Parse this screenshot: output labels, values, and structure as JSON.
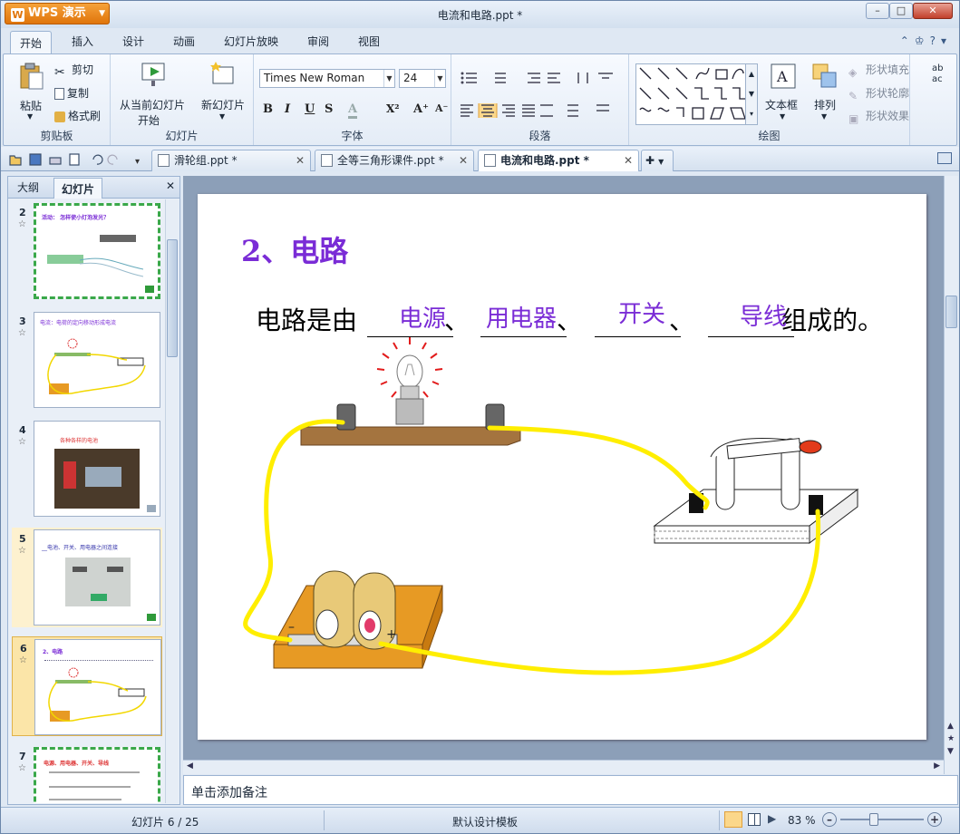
{
  "app": {
    "name": "WPS 演示",
    "title": "电流和电路.ppt *"
  },
  "window_controls": {
    "min": "–",
    "max": "□",
    "close": "✕"
  },
  "ribbon_tabs": [
    "开始",
    "插入",
    "设计",
    "动画",
    "幻灯片放映",
    "审阅",
    "视图"
  ],
  "clipboard": {
    "paste": "粘贴",
    "cut": "剪切",
    "copy": "复制",
    "format_painter": "格式刷",
    "label": "剪贴板"
  },
  "slides_group": {
    "from_current_line1": "从当前幻灯片",
    "from_current_line2": "开始",
    "new_slide": "新幻灯片",
    "label": "幻灯片"
  },
  "font": {
    "name": "Times New Roman",
    "size": "24",
    "label": "字体",
    "bold": "B",
    "italic": "I",
    "underline": "U",
    "strike": "S",
    "color": "A",
    "superscript": "X²",
    "grow": "A⁺",
    "shrink": "A⁻"
  },
  "paragraph": {
    "label": "段落"
  },
  "drawing": {
    "textbox": "文本框",
    "arrange": "排列",
    "shape_fill": "形状填充",
    "shape_outline": "形状轮廓",
    "shape_effect": "形状效果",
    "label": "绘图"
  },
  "doc_tabs": [
    {
      "label": "滑轮组.ppt *",
      "active": false
    },
    {
      "label": "全等三角形课件.ppt *",
      "active": false
    },
    {
      "label": "电流和电路.ppt *",
      "active": true
    }
  ],
  "left_pane": {
    "tabs": [
      "大纲",
      "幻灯片"
    ],
    "active_tab": "幻灯片",
    "thumbnails": [
      {
        "num": "2",
        "text": "活动：  怎样使小灯泡发光？"
      },
      {
        "num": "3",
        "text": "电流：电荷的定向移动形成电流"
      },
      {
        "num": "4",
        "text": "各种各样的电池"
      },
      {
        "num": "5",
        "text": "__电池、开关、用电器之间连接"
      },
      {
        "num": "6",
        "text": "2、电路",
        "selected": true
      },
      {
        "num": "7",
        "text": "电源、用电器、开关、导线"
      }
    ]
  },
  "slide": {
    "title": "2、电路",
    "sentence_start": "电路是由",
    "sep": "、",
    "sentence_end": "组成的。",
    "answers": [
      "电源",
      "用电器",
      "开关",
      "导线"
    ]
  },
  "notes_placeholder": "单击添加备注",
  "status": {
    "slide_counter": "幻灯片 6 / 25",
    "template": "默认设计模板",
    "zoom": "83 %"
  },
  "colors": {
    "accent": "#7a2cd6",
    "wire": "#ffee00",
    "wps_orange": "#e0750b"
  }
}
